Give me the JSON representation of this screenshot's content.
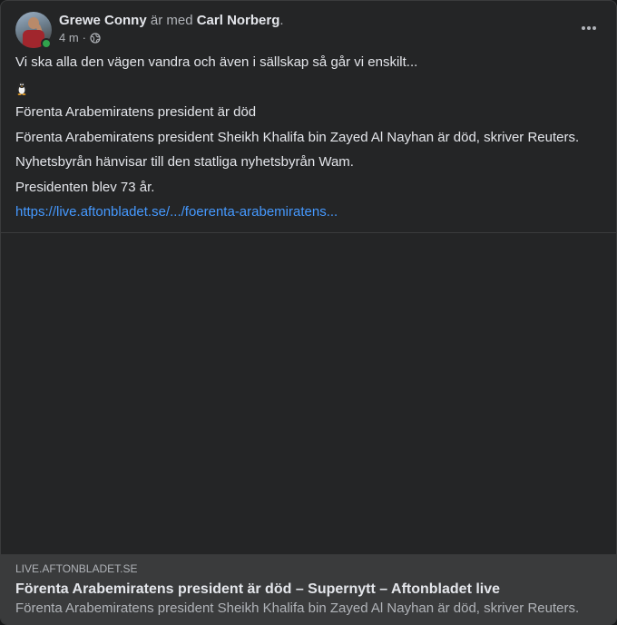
{
  "post": {
    "author": "Grewe Conny",
    "with_text": "är med",
    "tagged": "Carl Norberg",
    "period": ".",
    "time": "4 m",
    "separator": "·",
    "privacy_icon": "globe-icon",
    "more_icon": "more-horizontal-icon"
  },
  "body": {
    "line1": "Vi ska alla den vägen vandra och även i sällskap så går vi enskilt...",
    "emoji": "🐧",
    "line2": "Förenta Arabemiratens president är död",
    "line3": "Förenta Arabemiratens president Sheikh Khalifa bin Zayed Al Nayhan är död, skriver Reuters.",
    "line4": "Nyhetsbyrån hänvisar till den statliga nyhetsbyrån Wam.",
    "line5": "Presidenten blev 73 år.",
    "link": "https://live.aftonbladet.se/.../foerenta-arabemiratens..."
  },
  "link_preview": {
    "domain": "LIVE.AFTONBLADET.SE",
    "title": "Förenta Arabemiratens president är död – Supernytt – Aftonbladet live",
    "description": "Förenta Arabemiratens president Sheikh Khalifa bin Zayed Al Nayhan är död, skriver Reuters."
  },
  "colors": {
    "background": "#242526",
    "link": "#4599ff",
    "online": "#31a24c",
    "preview_bar": "#3a3b3c"
  }
}
